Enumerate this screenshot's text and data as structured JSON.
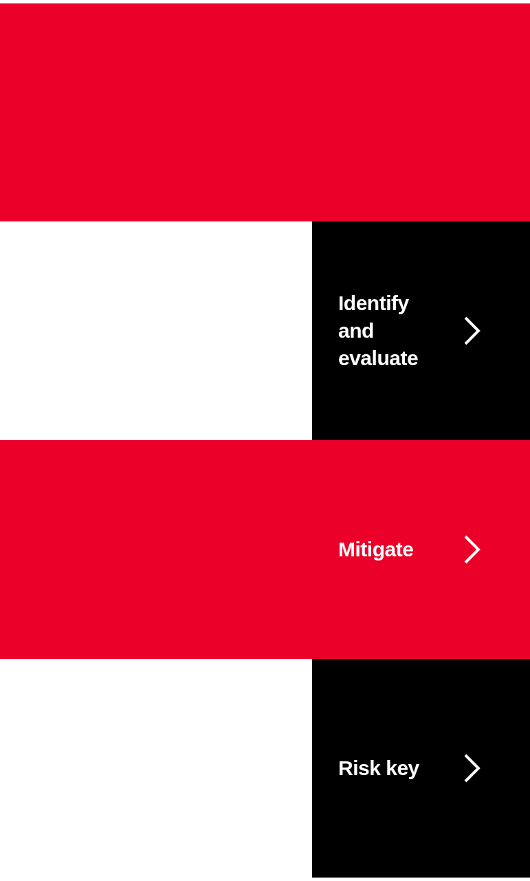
{
  "tiles": [
    {
      "label": "Identify and evaluate",
      "color": "#000000",
      "wide": false
    },
    {
      "label": "Mitigate",
      "color": "#ea0029",
      "wide": true
    },
    {
      "label": "Risk key",
      "color": "#000000",
      "wide": false
    }
  ]
}
